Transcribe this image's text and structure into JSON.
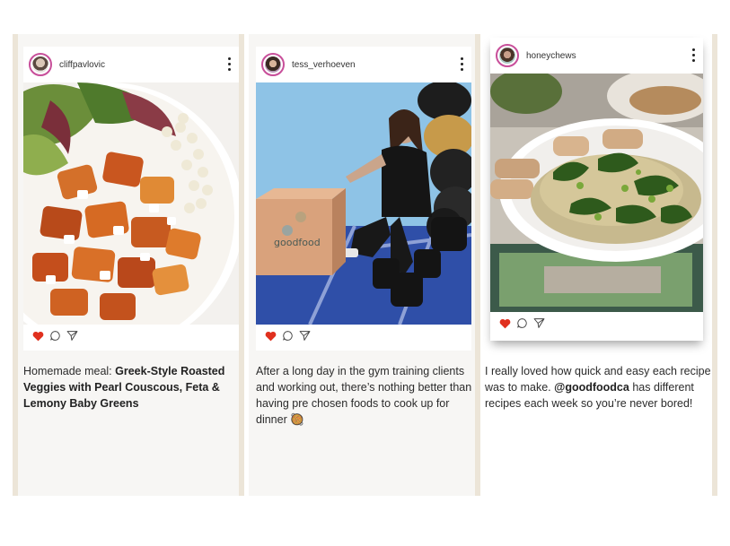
{
  "posts": [
    {
      "username": "cliffpavlovic",
      "caption_intro": "Homemade meal: ",
      "caption_bold": "Greek-Style Roasted Veggies with Pearl Couscous, Feta & Lemony Baby Greens"
    },
    {
      "username": "tess_verhoeven",
      "caption": "After a long day in the gym training clients and working out, there’s nothing better than having pre chosen foods to cook up for dinner",
      "caption_emoji": "🥘",
      "box_label": "goodfood"
    },
    {
      "username": "honeychews",
      "caption_pre": "I really loved how quick and easy each recipe was to make. ",
      "caption_mention": "@goodfoodca",
      "caption_post": " has different recipes each week so you’re never bored!"
    }
  ],
  "icons": {
    "like": "heart-icon",
    "comment": "comment-icon",
    "share": "send-icon",
    "menu": "more-vertical-icon"
  },
  "colors": {
    "like_red": "#e0301e",
    "avatar_ring": "#c84f9a",
    "column_border": "#ece5d8"
  }
}
